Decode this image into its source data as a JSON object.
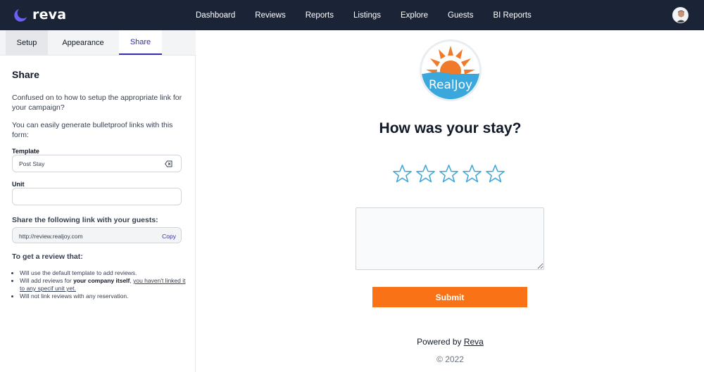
{
  "brand": {
    "name": "reva"
  },
  "nav": {
    "items": [
      "Dashboard",
      "Reviews",
      "Reports",
      "Listings",
      "Explore",
      "Guests",
      "BI Reports"
    ]
  },
  "tabs": {
    "setup": "Setup",
    "appearance": "Appearance",
    "share": "Share",
    "active": "Share"
  },
  "share_panel": {
    "heading": "Share",
    "intro1": "Confused on to how to setup the appropriate link for your campaign?",
    "intro2": "You can easily generate bulletproof links with this form:",
    "template_label": "Template",
    "template_value": "Post Stay",
    "unit_label": "Unit",
    "unit_value": "",
    "share_label": "Share the following link with your guests:",
    "link_value": "http://review.realjoy.com",
    "copy_label": "Copy",
    "review_label": "To get a review that:",
    "bullet1": "Will use the default template to add reviews.",
    "bullet2_prefix": "Will add reviews for ",
    "bullet2_bold": "your company itself",
    "bullet2_sep": ", ",
    "bullet2_link": "you haven't linked it to any specif unit yet.",
    "bullet3": "Will not link reviews with any reservation."
  },
  "preview": {
    "logo_text": "RealJoy",
    "title": "How was your stay?",
    "star_count": 5,
    "submit_label": "Submit",
    "powered_prefix": "Powered by ",
    "powered_link": "Reva",
    "copyright": "© 2022"
  },
  "colors": {
    "nav_bg": "#1b2436",
    "accent": "#3730a3",
    "submit": "#f97316",
    "star_outline": "#3fa7d6",
    "logo_orange": "#f07a2a",
    "logo_blue": "#3aa8dc"
  }
}
